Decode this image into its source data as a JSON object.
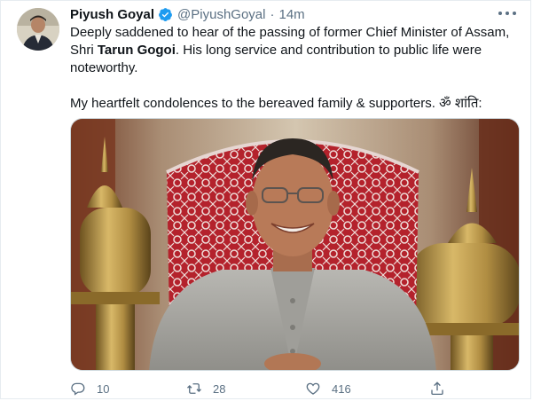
{
  "tweet": {
    "author_name": "Piyush Goyal",
    "handle": "@PiyushGoyal",
    "separator": "·",
    "time": "14m",
    "verified": true,
    "text": {
      "line1_before": "Deeply saddened to hear of the passing of former Chief Minister of Assam, Shri ",
      "line1_bold": "Tarun Gogoi",
      "line1_after": ". His long service and contribution to public life were noteworthy.",
      "line2": "My heartfelt condolences to the bereaved family & supporters. ॐ शांति:"
    },
    "actions": {
      "reply_count": "10",
      "retweet_count": "28",
      "like_count": "416"
    }
  },
  "colors": {
    "accent": "#1d9bf0",
    "muted": "#5b7083",
    "text": "#0f1419",
    "border": "#e6ecf0"
  },
  "icons": {
    "verified": "verified-badge-icon",
    "more": "more-options-icon",
    "reply": "reply-icon",
    "retweet": "retweet-icon",
    "like": "heart-icon",
    "share": "share-icon"
  }
}
